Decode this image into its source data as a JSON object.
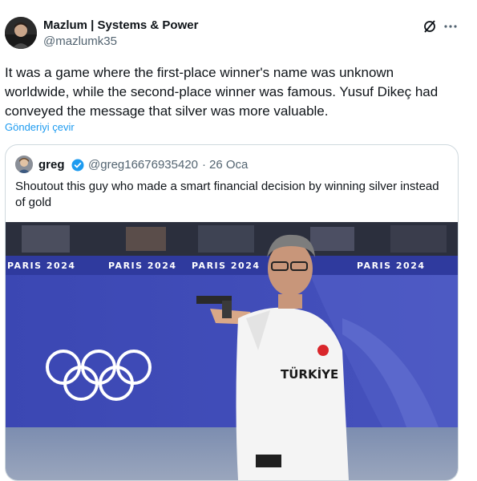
{
  "author": {
    "name": "Mazlum | Systems & Power",
    "handle": "@mazlumk35"
  },
  "tweet": {
    "text": "It was a game where the first-place winner's name was unknown worldwide, while the second-place winner was famous. Yusuf Dikeç had conveyed the message that silver was more valuable.",
    "translate_label": "Gönderiyi çevir"
  },
  "quote": {
    "name": "greg",
    "handle": "@greg16676935420",
    "separator": "·",
    "date": "26 Oca",
    "text": "Shoutout this guy who made a smart financial decision by winning silver instead of gold",
    "image": {
      "banner_text": "PARIS 2024",
      "shirt_text": "TÜRKİYE"
    }
  },
  "icons": {
    "grok": "grok-icon",
    "more": "more-icon",
    "verified": "verified-badge-icon",
    "verified_color": "#1d9bf0",
    "link_color": "#1d9bf0"
  }
}
